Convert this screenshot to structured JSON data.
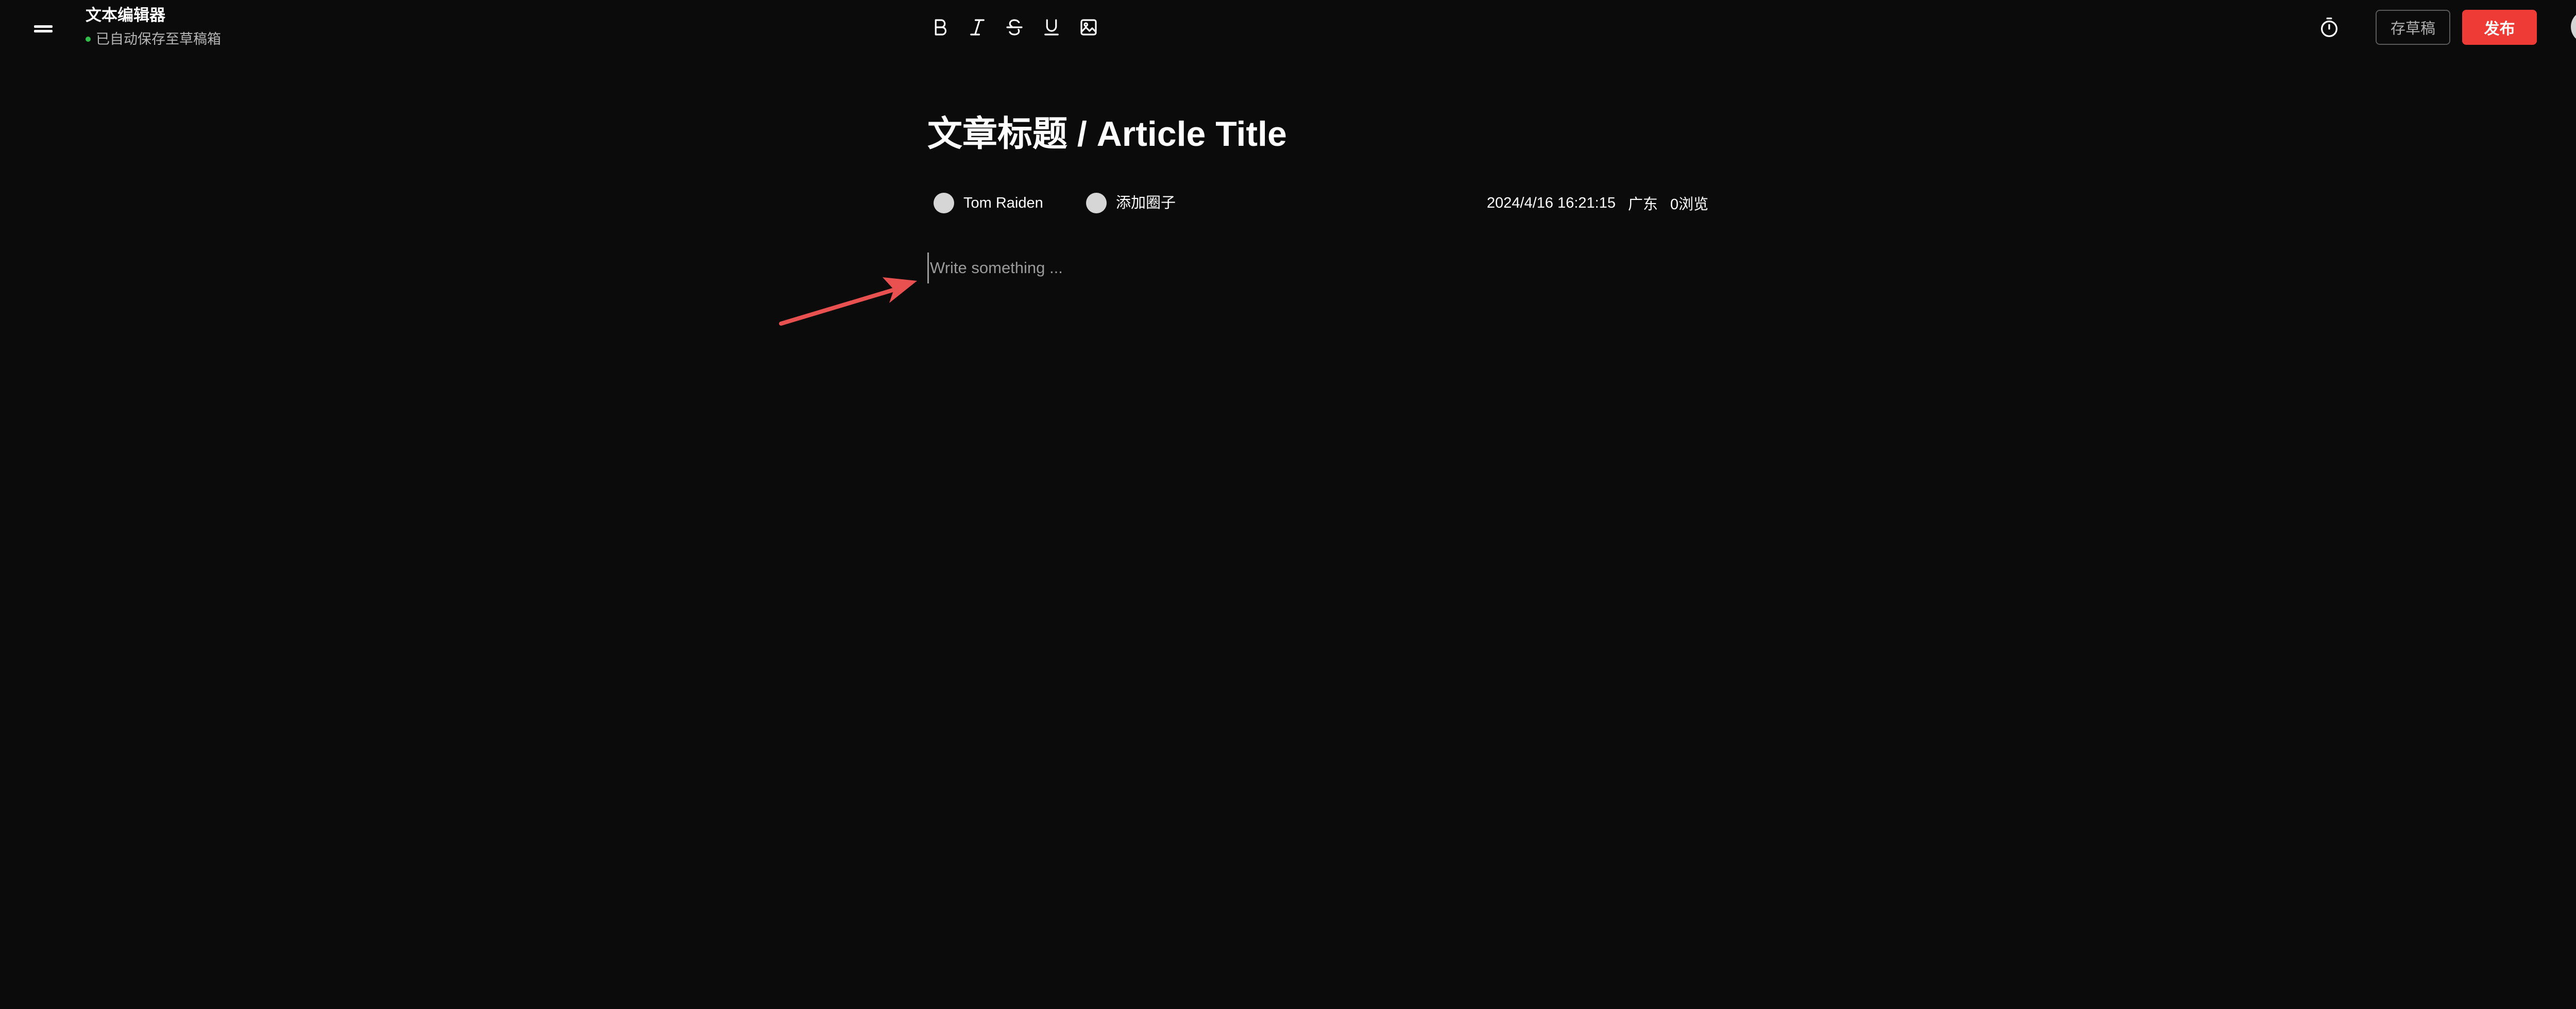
{
  "header": {
    "app_title": "文本编辑器",
    "save_status": "已自动保存至草稿箱",
    "draft_button": "存草稿",
    "publish_button": "发布"
  },
  "toolbar": {
    "tools": [
      {
        "name": "bold",
        "icon": "bold-icon"
      },
      {
        "name": "italic",
        "icon": "italic-icon"
      },
      {
        "name": "strikethrough",
        "icon": "strikethrough-icon"
      },
      {
        "name": "underline",
        "icon": "underline-icon"
      },
      {
        "name": "image",
        "icon": "image-icon"
      }
    ]
  },
  "article": {
    "title": "文章标题 / Article Title",
    "author": "Tom Raiden",
    "add_circle": "添加圈子",
    "datetime": "2024/4/16 16:21:15",
    "location": "广东",
    "views": "0浏览",
    "editor_placeholder": "Write something ..."
  },
  "colors": {
    "background": "#0b0b0b",
    "publish_accent": "#ee3b36",
    "status_dot": "#2fbf4a",
    "annotation_arrow": "#e8514f"
  },
  "icons": [
    "menu-icon",
    "timer-icon",
    "arrow-annotation"
  ]
}
